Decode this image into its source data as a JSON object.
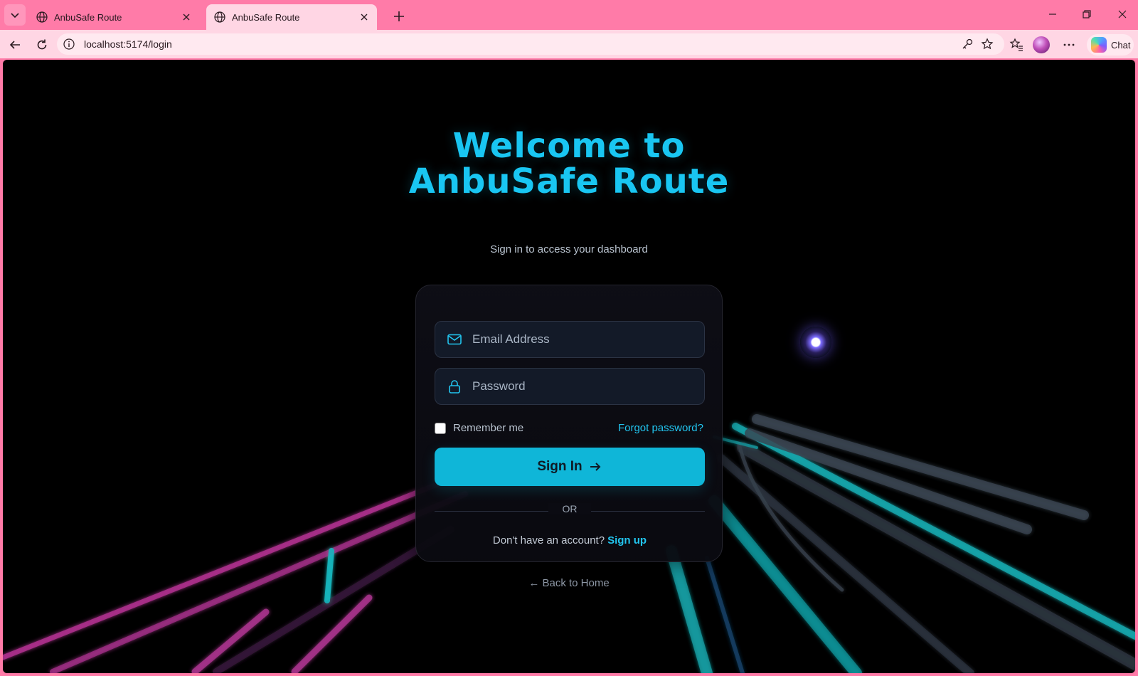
{
  "browser": {
    "tabs": [
      {
        "title": "AnbuSafe Route",
        "active": false
      },
      {
        "title": "AnbuSafe Route",
        "active": true
      }
    ],
    "url": "localhost:5174/login",
    "chat_label": "Chat"
  },
  "page": {
    "title": "Welcome to AnbuSafe Route",
    "subtitle": "Sign in to access your dashboard",
    "email_placeholder": "Email Address",
    "password_placeholder": "Password",
    "remember_label": "Remember me",
    "forgot_label": "Forgot password?",
    "signin_label": "Sign In",
    "or_label": "OR",
    "no_account_text": "Don't have an account?",
    "signup_label": "Sign up",
    "back_home_label": "← Back to Home"
  },
  "colors": {
    "chrome_tabbar": "#ff7ba8",
    "chrome_address": "#ffd6e4",
    "accent": "#19c6f2",
    "button": "#0fb6d8",
    "background": "#000000"
  }
}
